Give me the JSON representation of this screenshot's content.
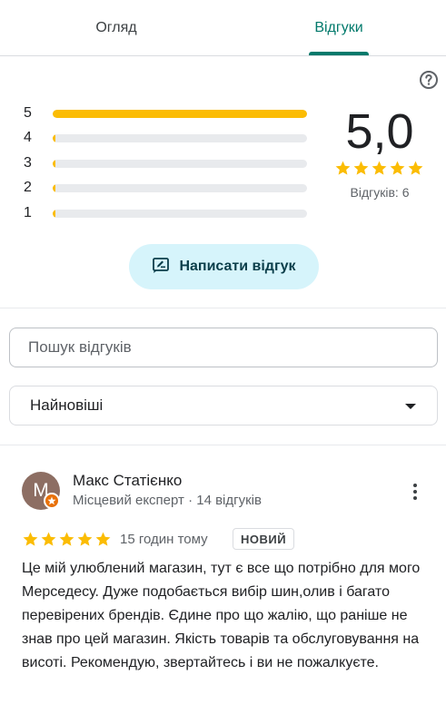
{
  "tabs": [
    {
      "label": "Огляд",
      "active": false
    },
    {
      "label": "Відгуки",
      "active": true
    }
  ],
  "rating_summary": {
    "average": "5,0",
    "reviews_label": "Відгуків: 6",
    "stars": 5,
    "bars": [
      {
        "label": "5",
        "fraction": 1.0
      },
      {
        "label": "4",
        "fraction": 0.0
      },
      {
        "label": "3",
        "fraction": 0.0
      },
      {
        "label": "2",
        "fraction": 0.0
      },
      {
        "label": "1",
        "fraction": 0.0
      }
    ]
  },
  "write_review": {
    "label": "Написати відгук"
  },
  "search": {
    "placeholder": "Пошук відгуків",
    "value": ""
  },
  "sort": {
    "selected": "Найновіші"
  },
  "review": {
    "avatar_letter": "М",
    "name": "Макс Статієнко",
    "meta": "Місцевий експерт · 14 відгуків",
    "stars": 5,
    "time": "15 годин тому",
    "badge": "НОВИЙ",
    "text": "Це мій улюблений магазин, тут є все що потрібно для мого Мерседесу. Дуже подобається вибір шин,олив і багато перевірених брендів. Єдине про що жалію, що раніше не знав про цей магазин. Якість товарів та обслуговування на висоті. Рекомендую, звертайтесь і ви не пожалкуєте."
  },
  "colors": {
    "accent": "#00796b",
    "star": "#fbbc04",
    "button_bg": "#d6f4fb",
    "badge_orange": "#e8710a"
  },
  "icons": [
    "help-icon",
    "edit-review-icon",
    "dropdown-arrow-icon",
    "more-vert-icon",
    "local-guide-icon",
    "star-icon"
  ]
}
